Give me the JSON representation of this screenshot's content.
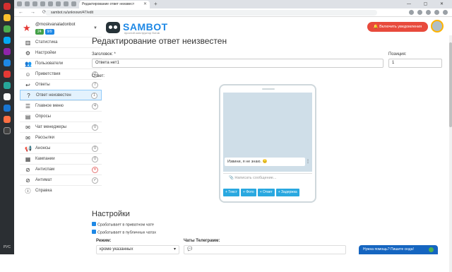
{
  "browser": {
    "active_tab": "Редактирование ответ неизвест",
    "url": "sambot.ru/unknown/47/edit"
  },
  "os": {
    "lang": "РУС"
  },
  "user": {
    "name": "@moskvanaladonbot",
    "badge_a": "24",
    "badge_b": "9/9"
  },
  "logo": {
    "title": "SAMBOT",
    "subtitle": "простой конструктор ботов"
  },
  "header": {
    "notify_label": "Включить уведомления"
  },
  "menu": [
    {
      "label": "Статистика",
      "icon": "chart-icon",
      "count": ""
    },
    {
      "label": "Настройки",
      "icon": "gear-icon",
      "count": ""
    },
    {
      "label": "Пользователи",
      "icon": "users-icon",
      "count": "1"
    },
    {
      "label": "Приветствия",
      "icon": "handshake-icon",
      "count": "2"
    },
    {
      "label": "Ответы",
      "icon": "reply-icon",
      "count": "7"
    },
    {
      "label": "Ответ неизвестен",
      "icon": "question-icon",
      "count": "1"
    },
    {
      "label": "Главное меню",
      "icon": "menu-icon",
      "count": "4"
    },
    {
      "label": "Опросы",
      "icon": "poll-icon",
      "count": ""
    },
    {
      "label": "Чат менеджеры",
      "icon": "chat-icon",
      "count": "0"
    },
    {
      "label": "Рассылки",
      "icon": "mail-icon",
      "count": ""
    },
    {
      "label": "Анонсы",
      "icon": "megaphone-icon",
      "count": "0"
    },
    {
      "label": "Кампании",
      "icon": "campaign-icon",
      "count": "0"
    },
    {
      "label": "Антиспам",
      "icon": "ban-icon",
      "count": "✕"
    },
    {
      "label": "Антимат",
      "icon": "shield-icon",
      "count": "✓"
    },
    {
      "label": "Справка",
      "icon": "info-icon",
      "count": ""
    }
  ],
  "page": {
    "title": "Редактирование ответ неизвестен",
    "heading_label": "Заголовок: *",
    "heading_value": "Ответа нет1",
    "position_label": "Позиция:",
    "position_value": "1",
    "answer_label": "Ответ:"
  },
  "phone": {
    "message": "Извини, я не знаю. 😔",
    "input_placeholder": "Написать сообщение...",
    "buttons": [
      "+ Текст",
      "+ Фото",
      "+ Ответ",
      "+ Задержка"
    ]
  },
  "settings": {
    "title": "Настройки",
    "check1": "Срабатывает в приватном чате",
    "check2": "Срабатывает в публичных чатах",
    "mode_label": "Режим:",
    "mode_value": "кроме указанных",
    "chats_label": "Чаты Телеграмм:"
  },
  "help": {
    "label": "Нужна помощь? Пишите сюда!"
  }
}
